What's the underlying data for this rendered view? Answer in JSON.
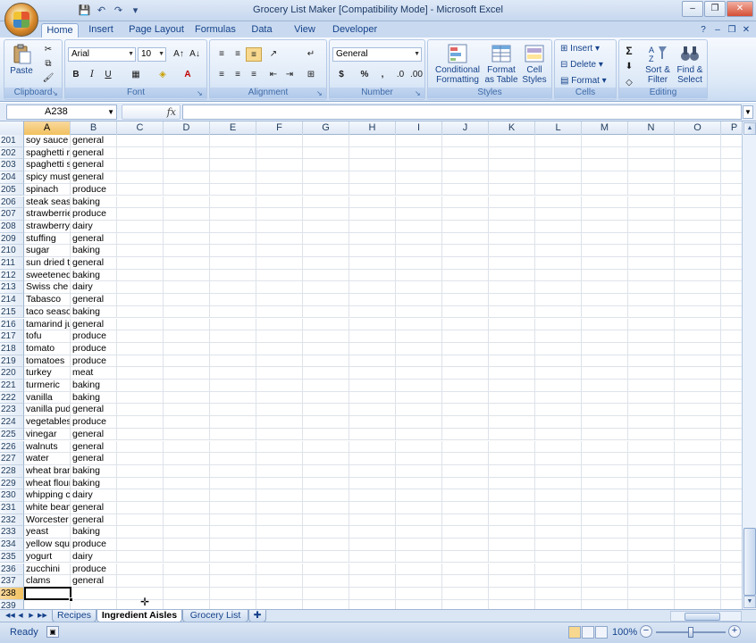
{
  "window": {
    "title": "Grocery List Maker  [Compatibility Mode] - Microsoft Excel",
    "controls": [
      "–",
      "❐",
      "✕"
    ]
  },
  "qat": {
    "save": "💾",
    "undo": "↶",
    "redo": "↷",
    "customize": "▾"
  },
  "ribbon_tabs": [
    "Home",
    "Insert",
    "Page Layout",
    "Formulas",
    "Data",
    "View",
    "Developer"
  ],
  "active_tab": "Home",
  "ribbon": {
    "clipboard": {
      "label": "Clipboard",
      "paste": "Paste"
    },
    "font": {
      "label": "Font",
      "family": "Arial",
      "size": "10",
      "bold": "B",
      "italic": "I",
      "underline": "U"
    },
    "alignment": {
      "label": "Alignment"
    },
    "number": {
      "label": "Number",
      "format": "General",
      "currency": "$",
      "percent": "%",
      "comma": ","
    },
    "styles": {
      "label": "Styles",
      "conditional": [
        "Conditional",
        "Formatting"
      ],
      "format_table": [
        "Format",
        "as Table"
      ],
      "cell_styles": [
        "Cell",
        "Styles"
      ]
    },
    "cells": {
      "label": "Cells",
      "insert": "Insert",
      "delete": "Delete",
      "format": "Format"
    },
    "editing": {
      "label": "Editing",
      "sort": [
        "Sort &",
        "Filter"
      ],
      "find": [
        "Find &",
        "Select"
      ]
    }
  },
  "name_box": "A238",
  "formula_label": "fx",
  "columns": [
    "A",
    "B",
    "C",
    "D",
    "E",
    "F",
    "G",
    "H",
    "I",
    "J",
    "K",
    "L",
    "M",
    "N",
    "O",
    "P"
  ],
  "rows": [
    {
      "n": "201",
      "a": "soy sauce",
      "b": "general"
    },
    {
      "n": "202",
      "a": "spaghetti r",
      "b": "general"
    },
    {
      "n": "203",
      "a": "spaghetti s",
      "b": "general"
    },
    {
      "n": "204",
      "a": "spicy must",
      "b": "general"
    },
    {
      "n": "205",
      "a": "spinach",
      "b": "produce"
    },
    {
      "n": "206",
      "a": "steak seas",
      "b": "baking"
    },
    {
      "n": "207",
      "a": "strawberrie",
      "b": "produce"
    },
    {
      "n": "208",
      "a": "strawberry",
      "b": "dairy"
    },
    {
      "n": "209",
      "a": "stuffing",
      "b": "general"
    },
    {
      "n": "210",
      "a": "sugar",
      "b": "baking"
    },
    {
      "n": "211",
      "a": "sun dried t",
      "b": "general"
    },
    {
      "n": "212",
      "a": "sweetened",
      "b": "baking"
    },
    {
      "n": "213",
      "a": "Swiss che",
      "b": "dairy"
    },
    {
      "n": "214",
      "a": "Tabasco",
      "b": "general"
    },
    {
      "n": "215",
      "a": "taco seaso",
      "b": "baking"
    },
    {
      "n": "216",
      "a": "tamarind ju",
      "b": "general"
    },
    {
      "n": "217",
      "a": "tofu",
      "b": "produce"
    },
    {
      "n": "218",
      "a": "tomato",
      "b": "produce"
    },
    {
      "n": "219",
      "a": "tomatoes",
      "b": "produce"
    },
    {
      "n": "220",
      "a": "turkey",
      "b": "meat"
    },
    {
      "n": "221",
      "a": "turmeric",
      "b": "baking"
    },
    {
      "n": "222",
      "a": "vanilla",
      "b": "baking"
    },
    {
      "n": "223",
      "a": "vanilla pud",
      "b": "general"
    },
    {
      "n": "224",
      "a": "vegetables",
      "b": "produce"
    },
    {
      "n": "225",
      "a": "vinegar",
      "b": "general"
    },
    {
      "n": "226",
      "a": "walnuts",
      "b": "general"
    },
    {
      "n": "227",
      "a": "water",
      "b": "general"
    },
    {
      "n": "228",
      "a": "wheat bran",
      "b": "baking"
    },
    {
      "n": "229",
      "a": "wheat flour",
      "b": "baking"
    },
    {
      "n": "230",
      "a": "whipping c",
      "b": "dairy"
    },
    {
      "n": "231",
      "a": "white bean",
      "b": "general"
    },
    {
      "n": "232",
      "a": "Worcester",
      "b": "general"
    },
    {
      "n": "233",
      "a": "yeast",
      "b": "baking"
    },
    {
      "n": "234",
      "a": "yellow squ",
      "b": "produce"
    },
    {
      "n": "235",
      "a": "yogurt",
      "b": "dairy"
    },
    {
      "n": "236",
      "a": "zucchini",
      "b": "produce"
    },
    {
      "n": "237",
      "a": "clams",
      "b": "general"
    },
    {
      "n": "238",
      "a": "",
      "b": ""
    },
    {
      "n": "239",
      "a": "",
      "b": ""
    }
  ],
  "sheets": [
    "Recipes",
    "Ingredient Aisles",
    "Grocery List"
  ],
  "active_sheet": "Ingredient Aisles",
  "status": {
    "text": "Ready",
    "zoom": "100%"
  },
  "colors": {
    "accent": "#15428b",
    "selection": "#f1c15f"
  }
}
